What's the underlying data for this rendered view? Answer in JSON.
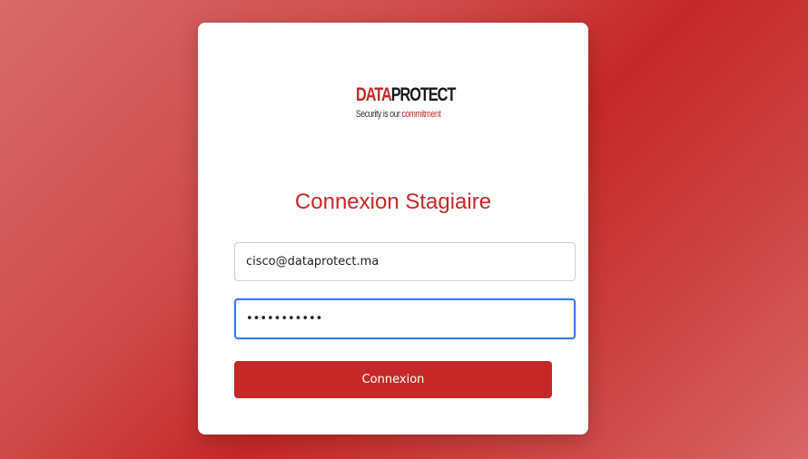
{
  "logo": {
    "brand_part1": "DATA",
    "brand_part2": "PROTECT",
    "tagline_part1": "Security is our ",
    "tagline_part2": "commitment"
  },
  "form": {
    "title": "Connexion Stagiaire",
    "email_value": "cisco@dataprotect.ma",
    "password_value": "ccccccccccc",
    "submit_label": "Connexion"
  },
  "colors": {
    "accent": "#c62828",
    "focus_border": "#3b78e7",
    "card_background": "#ffffff"
  }
}
